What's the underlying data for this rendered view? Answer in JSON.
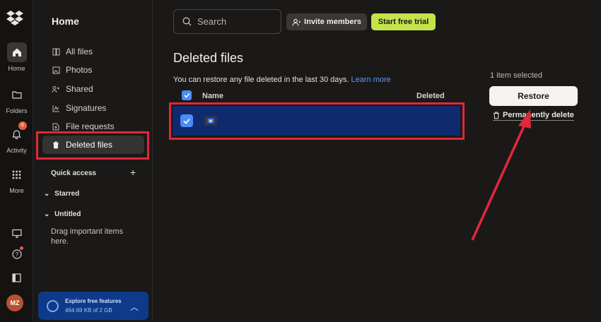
{
  "rail": {
    "items": [
      {
        "label": "Home"
      },
      {
        "label": "Folders"
      },
      {
        "label": "Activity",
        "badge": "6"
      },
      {
        "label": "More"
      }
    ],
    "avatar_initials": "MZ"
  },
  "sidebar": {
    "title": "Home",
    "items": [
      {
        "label": "All files",
        "icon": "all-files-icon"
      },
      {
        "label": "Photos",
        "icon": "photos-icon"
      },
      {
        "label": "Shared",
        "icon": "shared-icon"
      },
      {
        "label": "Signatures",
        "icon": "signatures-icon"
      },
      {
        "label": "File requests",
        "icon": "file-requests-icon"
      },
      {
        "label": "Deleted files",
        "icon": "trash-icon",
        "active": true
      }
    ],
    "quick_access": "Quick access",
    "starred": "Starred",
    "untitled": "Untitled",
    "drag_hint": "Drag important items here.",
    "explore": {
      "title": "Explore free features",
      "storage": "464.69 KB of 2 GB"
    }
  },
  "header": {
    "search_placeholder": "Search",
    "invite_label": "Invite members",
    "trial_label": "Start free trial"
  },
  "main": {
    "title": "Deleted files",
    "info": "You can restore any file deleted in the last 30 days.",
    "learn_more": "Learn more",
    "columns": {
      "name": "Name",
      "deleted": "Deleted"
    },
    "selection": "1 item selected",
    "restore_label": "Restore",
    "perm_delete_label": "Permanently delete"
  },
  "colors": {
    "accent_blue": "#4a8df8",
    "highlight_red": "#e0283a",
    "trial_green": "#c4e34b",
    "selected_row": "#102a6e"
  }
}
